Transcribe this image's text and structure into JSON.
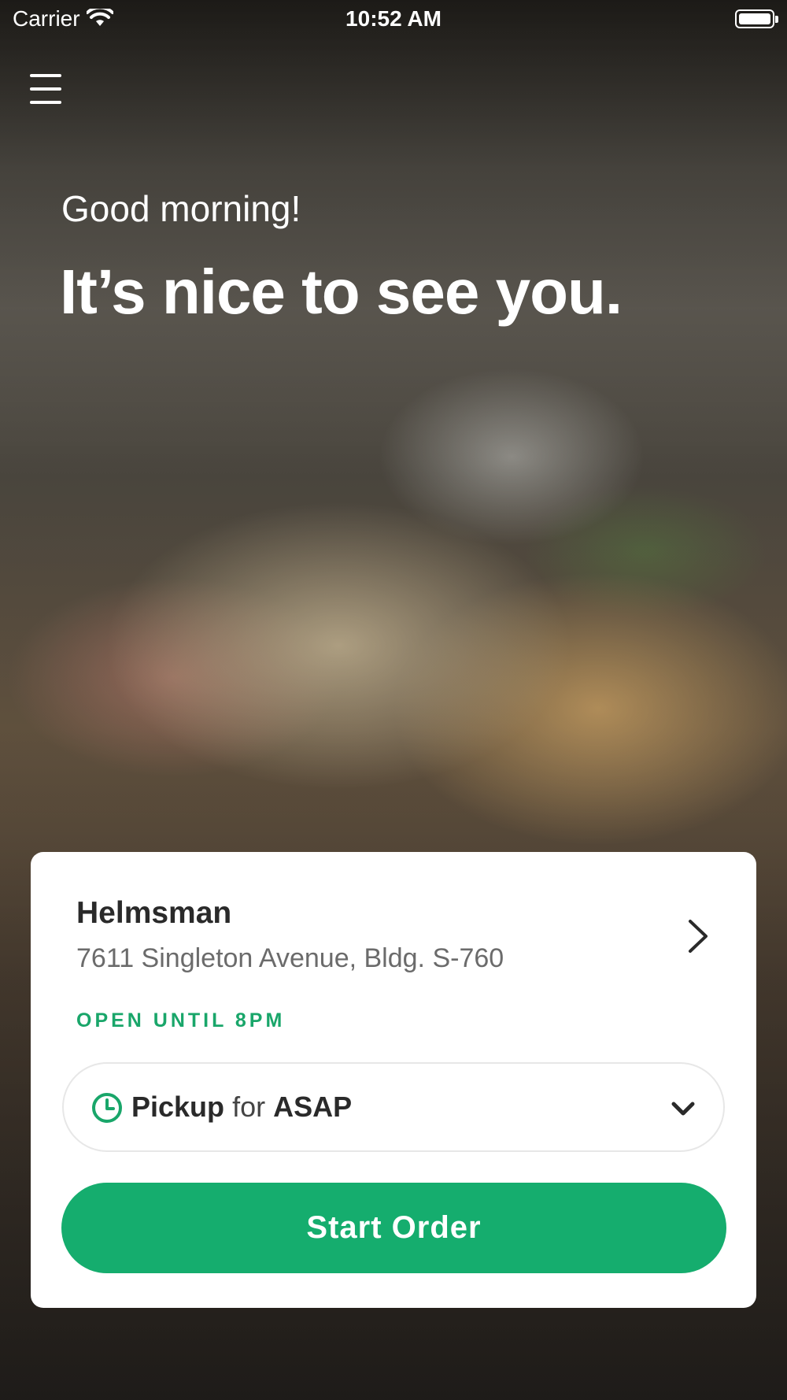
{
  "status_bar": {
    "carrier": "Carrier",
    "time": "10:52 AM",
    "icons": [
      "wifi-icon",
      "battery-icon"
    ]
  },
  "header": {
    "menu_icon": "hamburger-menu-icon"
  },
  "greeting": {
    "salutation": "Good morning!",
    "headline": "It’s nice to see you."
  },
  "store_card": {
    "name": "Helmsman",
    "address": "7611 Singleton Avenue, Bldg. S-760",
    "hours": "OPEN UNTIL 8PM",
    "chevron_icon": "chevron-right-icon"
  },
  "order_mode": {
    "mode": "Pickup",
    "connector": "for",
    "time": "ASAP",
    "clock_icon": "clock-icon",
    "dropdown_icon": "chevron-down-icon"
  },
  "actions": {
    "start_order_label": "Start Order"
  },
  "colors": {
    "accent": "#15ad6e",
    "hours_text": "#19a66a",
    "card_background": "#ffffff",
    "title_text": "#2a2a2a",
    "secondary_text": "#6b6b6b"
  }
}
